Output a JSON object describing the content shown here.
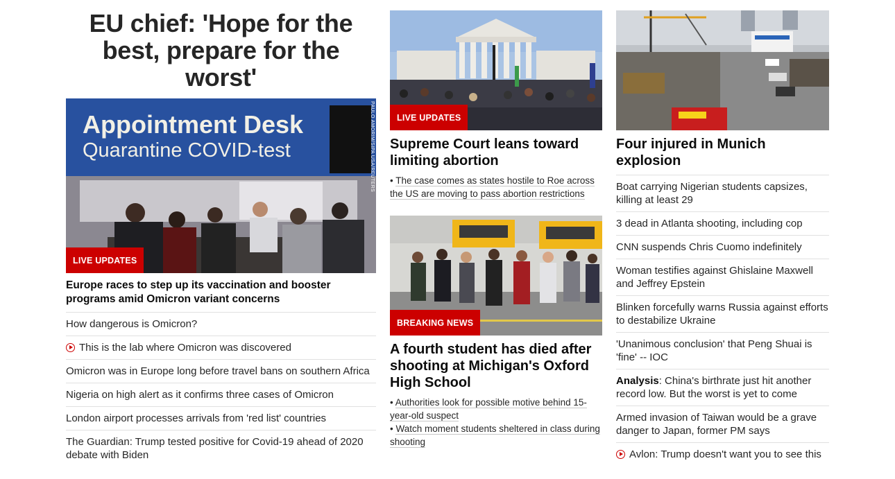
{
  "col1": {
    "headline": "EU chief: 'Hope for the best, prepare for the worst'",
    "image": {
      "sign_line1": "Appointment Desk",
      "sign_line2": "Quarantine COVID-test",
      "credit": "PAULO AMORIM/SIPA USA/REUTERS",
      "badge": "LIVE UPDATES"
    },
    "story_title": "Europe races to step up its vaccination and booster programs amid Omicron variant concerns",
    "items": [
      {
        "text": "How dangerous is Omicron?",
        "video": false
      },
      {
        "text": "This is the lab where Omicron was discovered",
        "video": true
      },
      {
        "text": "Omicron was in Europe long before travel bans on southern Africa",
        "video": false
      },
      {
        "text": "Nigeria on high alert as it confirms three cases of Omicron",
        "video": false
      },
      {
        "text": "London airport processes arrivals from 'red list' countries",
        "video": false
      },
      {
        "text": "The Guardian: Trump tested positive for Covid-19 ahead of 2020 debate with Biden",
        "video": false
      }
    ]
  },
  "col2": {
    "story1": {
      "badge": "LIVE UPDATES",
      "title": "Supreme Court leans toward limiting abortion",
      "bullets": [
        "The case comes as states hostile to Roe across the US are moving to pass abortion restrictions"
      ]
    },
    "story2": {
      "badge": "BREAKING NEWS",
      "title": "A fourth student has died after shooting at Michigan's Oxford High School",
      "bullets": [
        "Authorities look for possible motive behind 15-year-old suspect",
        "Watch moment students sheltered in class during shooting"
      ]
    }
  },
  "col3": {
    "title": "Four injured in Munich explosion",
    "items": [
      {
        "text": "Boat carrying Nigerian students capsizes, killing at least 29",
        "video": false
      },
      {
        "text": "3 dead in Atlanta shooting, including cop",
        "video": false
      },
      {
        "text": "CNN suspends Chris Cuomo indefinitely",
        "video": false
      },
      {
        "text": "Woman testifies against Ghislaine Maxwell and Jeffrey Epstein",
        "video": false
      },
      {
        "text": "Blinken forcefully warns Russia against efforts to destabilize Ukraine",
        "video": false
      },
      {
        "text": "'Unanimous conclusion' that Peng Shuai is 'fine' -- IOC",
        "video": false
      },
      {
        "prefix": "Analysis",
        "text": ": China's birthrate just hit another record low. But the worst is yet to come",
        "video": false
      },
      {
        "text": "Armed invasion of Taiwan would be a grave danger to Japan, former PM says",
        "video": false
      },
      {
        "text": "Avlon: Trump doesn't want you to see this",
        "video": true
      }
    ]
  },
  "colors": {
    "accent": "#cc0000",
    "text": "#0c0c0c",
    "divider": "#e0e0e0"
  }
}
